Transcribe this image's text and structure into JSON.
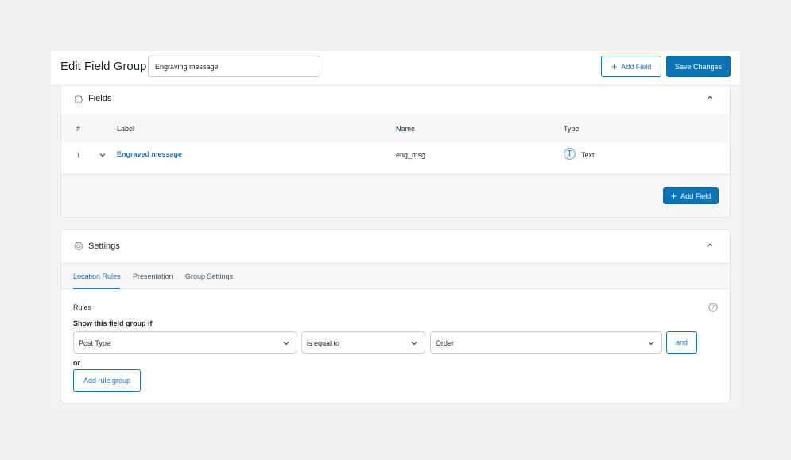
{
  "header": {
    "title": "Edit Field Group",
    "group_title_value": "Engraving message",
    "add_field_label": "Add Field",
    "save_label": "Save Changes"
  },
  "fields_panel": {
    "title": "Fields",
    "icon": "puzzle-icon",
    "columns": {
      "num": "#",
      "label": "Label",
      "name": "Name",
      "type": "Type"
    },
    "rows": [
      {
        "num": "1",
        "label": "Engraved message",
        "name": "eng_msg",
        "type": "Text",
        "type_icon_letter": "T"
      }
    ],
    "add_field_label": "Add Field"
  },
  "settings_panel": {
    "title": "Settings",
    "icon": "gear-icon",
    "tabs": [
      "Location Rules",
      "Presentation",
      "Group Settings"
    ],
    "active_tab": "Location Rules",
    "rules_label": "Rules",
    "condition_label": "Show this field group if",
    "rule": {
      "param": "Post Type",
      "operator": "is equal to",
      "value": "Order"
    },
    "and_label": "and",
    "or_label": "or",
    "add_rule_group_label": "Add rule group"
  },
  "colors": {
    "accent": "#2271b1",
    "primary_button": "#0a74b6",
    "background": "#f0f0f1"
  }
}
